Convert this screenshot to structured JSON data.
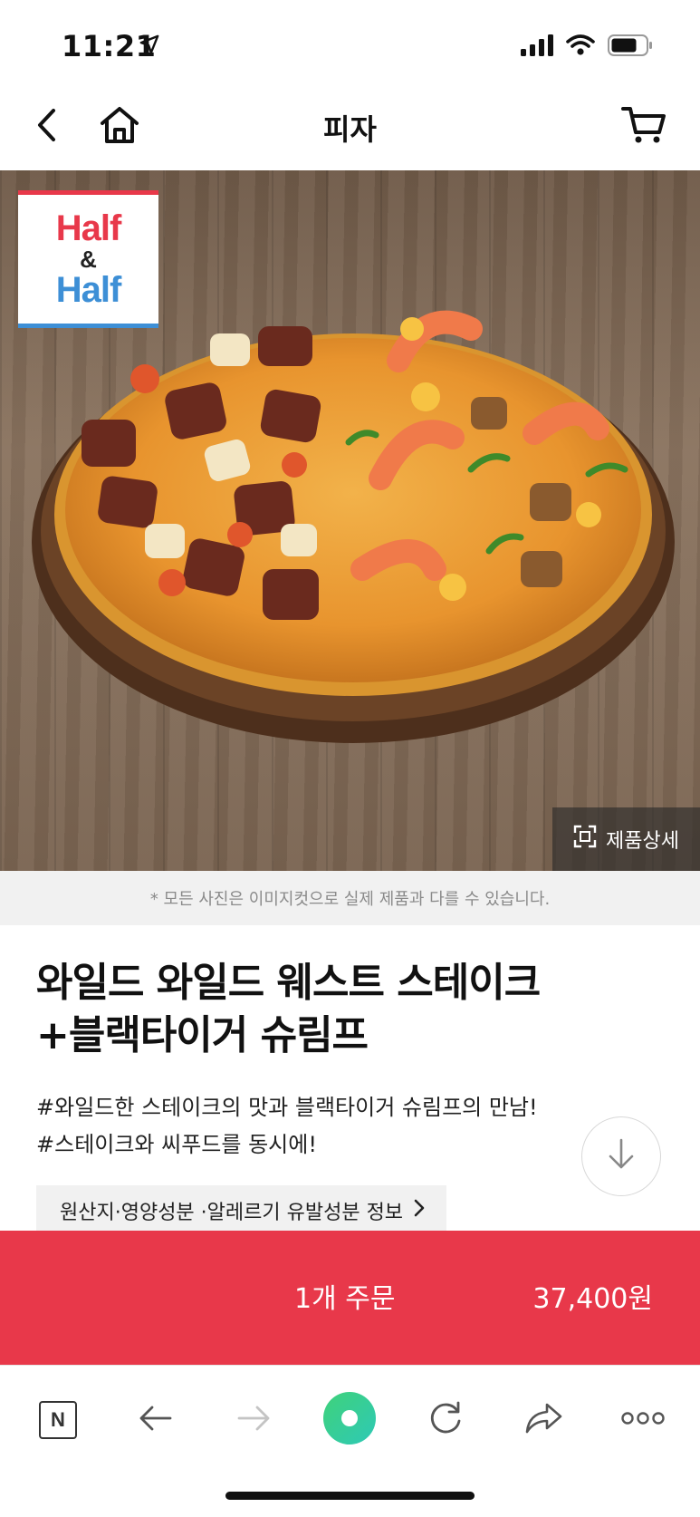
{
  "status_bar": {
    "time": "11:21"
  },
  "nav": {
    "title": "피자"
  },
  "hero": {
    "badge_line1": "Half",
    "badge_amp": "&",
    "badge_line2": "Half",
    "detail_label": "제품상세"
  },
  "notice": "* 모든 사진은 이미지컷으로 실제 제품과 다를 수 있습니다.",
  "product": {
    "title_line1": "와일드 와일드 웨스트 스테이크",
    "title_line2": "+블랙타이거 슈림프",
    "desc_line1": "#와일드한 스테이크의 맛과 블랙타이거 슈림프의 만남!",
    "desc_line2": "#스테이크와 씨푸드를 동시에!",
    "info_link": "원산지·영양성분 ·알레르기 유발성분 정보"
  },
  "order": {
    "label": "1개 주문",
    "price": "37,400원"
  },
  "browser": {
    "naver_letter": "N"
  },
  "colors": {
    "accent": "#e8384a",
    "badge_blue": "#3d8fd6"
  },
  "icons": [
    "back-icon",
    "home-icon",
    "cart-icon",
    "expand-icon",
    "arrow-down-icon",
    "chevron-right-icon",
    "naver-icon",
    "browser-back-icon",
    "browser-forward-icon",
    "green-dot-icon",
    "reload-icon",
    "share-icon",
    "more-icon"
  ]
}
